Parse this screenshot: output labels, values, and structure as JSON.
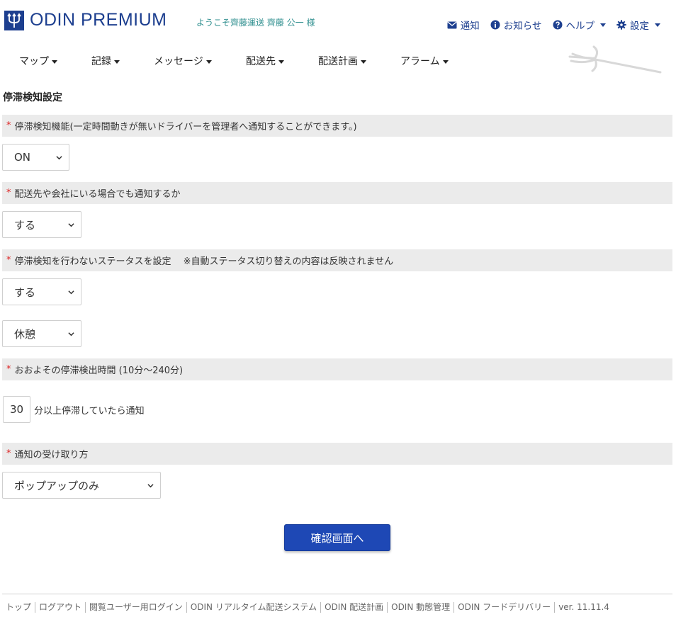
{
  "header": {
    "logo_text": "ODIN PREMIUM",
    "welcome": "ようこそ齊藤運送 齊藤 公一 様",
    "links": {
      "notify": "通知",
      "news": "お知らせ",
      "help": "ヘルプ",
      "settings": "設定"
    }
  },
  "nav": {
    "map": "マップ",
    "records": "記録",
    "messages": "メッセージ",
    "destinations": "配送先",
    "plans": "配送計画",
    "alarms": "アラーム"
  },
  "page": {
    "title": "停滞検知設定"
  },
  "form": {
    "function": {
      "label": "停滞検知機能(一定時間動きが無いドライバーを管理者へ通知することができます。)",
      "value": "ON"
    },
    "at_location": {
      "label": "配送先や会社にいる場合でも通知するか",
      "value": "する"
    },
    "status": {
      "label": "停滞検知を行わないステータスを設定　 ※自動ステータス切り替えの内容は反映されません",
      "enable_value": "する",
      "status_value": "休憩"
    },
    "duration": {
      "label": "おおよその停滞検出時間 (10分～240分)",
      "value": "30",
      "suffix": "分以上停滞していたら通知"
    },
    "receive": {
      "label": "通知の受け取り方",
      "value": "ポップアップのみ"
    },
    "required_mark": "*",
    "confirm_label": "確認画面へ"
  },
  "footer": {
    "links": [
      "トップ",
      "ログアウト",
      "閲覧ユーザー用ログイン",
      "ODIN リアルタイム配送システム",
      "ODIN 配送計画",
      "ODIN 動態管理",
      "ODIN フードデリバリー"
    ],
    "version": "ver. 11.11.4"
  },
  "colors": {
    "brand": "#1d3f8f",
    "section_bg": "#ebebeb",
    "button": "#1e48b5",
    "required": "#dd2222",
    "welcome": "#2f8f8f"
  },
  "icons": [
    "trident-logo-icon",
    "envelope-icon",
    "info-icon",
    "question-icon",
    "gear-icon",
    "chevron-down-icon"
  ]
}
